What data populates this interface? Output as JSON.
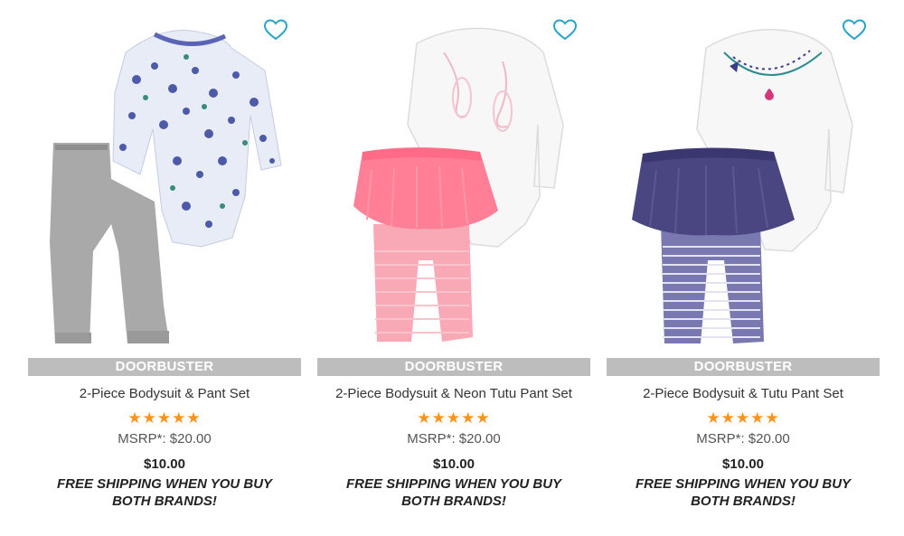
{
  "colors": {
    "badge_bg": "#bdbdbd",
    "star": "#f7941d",
    "heart": "#29a3c7"
  },
  "products": [
    {
      "badge": "DOORBUSTER",
      "name": "2-Piece Bodysuit & Pant Set",
      "rating": 5,
      "stars": "★★★★★",
      "msrp": "MSRP*: $20.00",
      "price": "$10.00",
      "shipping": "FREE SHIPPING WHEN YOU BUY BOTH BRANDS!",
      "icon": "heart-icon"
    },
    {
      "badge": "DOORBUSTER",
      "name": "2-Piece Bodysuit & Neon Tutu Pant Set",
      "rating": 5,
      "stars": "★★★★★",
      "msrp": "MSRP*: $20.00",
      "price": "$10.00",
      "shipping": "FREE SHIPPING WHEN YOU BUY BOTH BRANDS!",
      "icon": "heart-icon"
    },
    {
      "badge": "DOORBUSTER",
      "name": "2-Piece Bodysuit & Tutu Pant Set",
      "rating": 5,
      "stars": "★★★★★",
      "msrp": "MSRP*: $20.00",
      "price": "$10.00",
      "shipping": "FREE SHIPPING WHEN YOU BUY BOTH BRANDS!",
      "icon": "heart-icon"
    }
  ]
}
